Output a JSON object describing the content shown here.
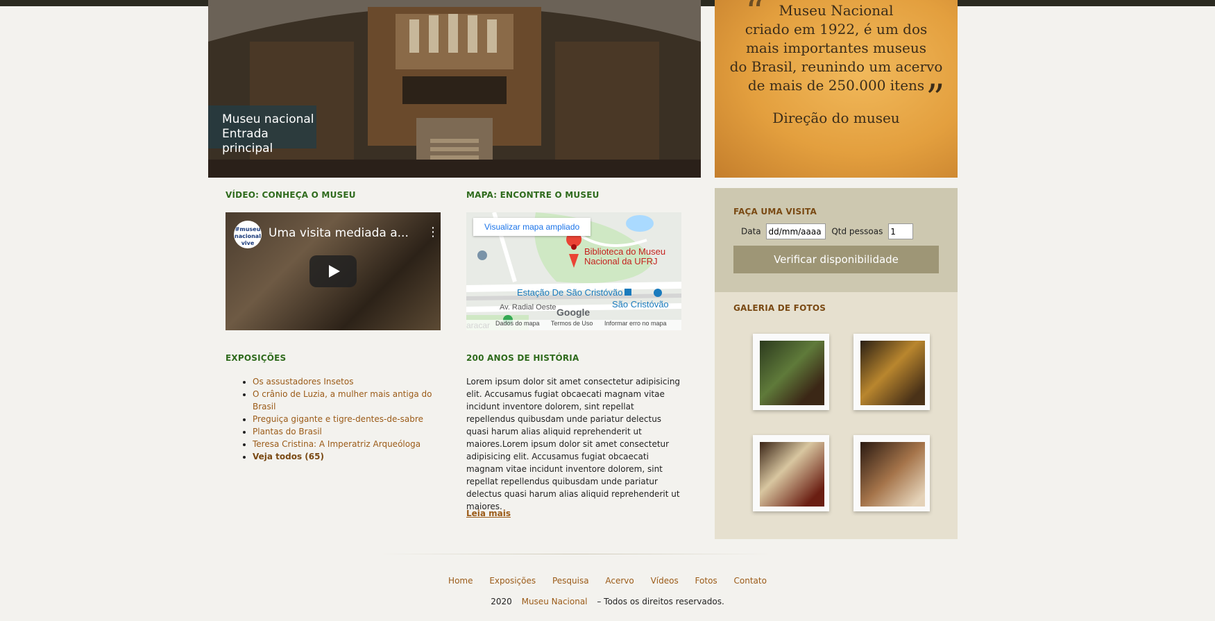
{
  "hero": {
    "caption_line1": "Museu nacional",
    "caption_line2": "Entrada principal"
  },
  "quote": {
    "line1": "Museu Nacional",
    "line2": "criado em 1922, é um dos",
    "line3": "mais importantes museus",
    "line4": "do Brasil, reunindo um acervo",
    "line5": "de mais de 250.000 itens",
    "signature": "Direção do museu",
    "open_mark": "“",
    "close_mark": "”"
  },
  "video": {
    "heading": "VÍDEO: CONHEÇA O MUSEU",
    "title": "Uma visita mediada a...",
    "channel_logo": "#museu nacional vive",
    "menu_icon": "⋮"
  },
  "map": {
    "heading": "MAPA: ENCONTRE O MUSEU",
    "enlarge_label": "Visualizar mapa ampliado",
    "place_line1": "Biblioteca do Museu",
    "place_line2": "Nacional da UFRJ",
    "station": "Estação De São Cristóvão",
    "station2": "São Cristóvão",
    "road": "Av. Radial Oeste",
    "brand": "Google",
    "corner_text": "aracar",
    "footer": [
      "Dados do mapa",
      "Termos de Uso",
      "Informar erro no mapa"
    ]
  },
  "exposicoes": {
    "heading": "EXPOSIÇÕES",
    "items": [
      "Os assustadores Insetos",
      "O crânio de Luzia, a mulher mais antiga do Brasil",
      "Preguiça gigante e tigre-dentes-de-sabre",
      "Plantas do Brasil",
      "Teresa Cristina: A Imperatriz Arqueóloga"
    ],
    "see_all": "Veja todos (65)"
  },
  "historia": {
    "heading": "200 ANOS DE HISTÓRIA",
    "text": "Lorem ipsum dolor sit amet consectetur adipisicing elit. Accusamus fugiat obcaecati magnam vitae incidunt inventore dolorem, sint repellat repellendus quibusdam unde pariatur delectus quasi harum alias aliquid reprehenderit ut maiores.Lorem ipsum dolor sit amet consectetur adipisicing elit. Accusamus fugiat obcaecati magnam vitae incidunt inventore dolorem, sint repellat repellendus quibusdam unde pariatur delectus quasi harum alias aliquid reprehenderit ut maiores.",
    "read_more": "Leia mais"
  },
  "visit": {
    "heading": "FAÇA UMA VISITA",
    "date_label": "Data",
    "date_value": "dd/mm/aaaa",
    "qty_label": "Qtd pessoas",
    "qty_value": "1",
    "button": "Verificar disponibilidade"
  },
  "gallery": {
    "heading": "GALERIA DE FOTOS"
  },
  "footer": {
    "nav": [
      "Home",
      "Exposições",
      "Pesquisa",
      "Acervo",
      "Vídeos",
      "Fotos",
      "Contato"
    ],
    "year": "2020",
    "site": "Museu Nacional",
    "rights": "– Todos os direitos reservados."
  },
  "colors": {
    "heading_green": "#2f6b1d",
    "link_brown": "#9b5b18",
    "visit_bg": "#cdc8b0",
    "gallery_bg": "#e6e0cf",
    "button_bg": "#9e9676"
  }
}
